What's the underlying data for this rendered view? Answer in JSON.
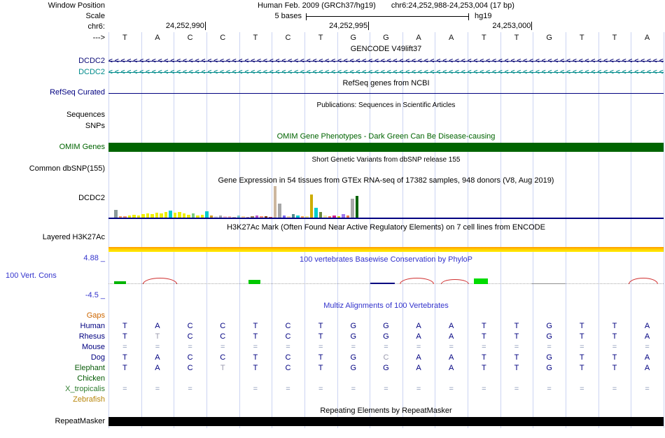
{
  "header": {
    "window_position_label": "Window Position",
    "assembly": "Human Feb. 2009 (GRCh37/hg19)",
    "position": "chr6:24,252,988-24,253,004 (17 bp)",
    "scale_label": "Scale",
    "scale_text": "5 bases",
    "assembly_short": "hg19",
    "chrom_label": "chr6:",
    "strand_arrow": "--->",
    "ruler_ticks": [
      {
        "label": "24,252,990",
        "boundary": 3
      },
      {
        "label": "24,252,995",
        "boundary": 8
      },
      {
        "label": "24,253,000",
        "boundary": 13
      }
    ],
    "sequence": [
      "T",
      "A",
      "C",
      "C",
      "T",
      "C",
      "T",
      "G",
      "G",
      "A",
      "A",
      "T",
      "T",
      "G",
      "T",
      "T",
      "A"
    ]
  },
  "gencode": {
    "title": "GENCODE V49lift37",
    "transcripts": [
      {
        "label": "DCDC2",
        "color": "#0c0c78",
        "strand": "<"
      },
      {
        "label": "DCDC2",
        "color": "#008b8b",
        "strand": "<"
      }
    ]
  },
  "refseq": {
    "label": "RefSeq Curated",
    "title": "RefSeq genes from NCBI",
    "color": "#000080"
  },
  "publications": {
    "title": "Publications: Sequences in Scientific Articles"
  },
  "sequences": {
    "label": "Sequences"
  },
  "snps": {
    "label": "SNPs"
  },
  "omim": {
    "label": "OMIM Genes",
    "title": "OMIM Gene Phenotypes - Dark Green Can Be Disease-causing",
    "color": "#006400"
  },
  "dbsnp": {
    "label": "Common dbSNP(155)",
    "title": "Short Genetic Variants from dbSNP release 155"
  },
  "gtex": {
    "label": "DCDC2",
    "title": "Gene Expression in 54 tissues from GTEx RNA-seq of 17382 samples, 948 donors (V8, Aug 2019)",
    "baseline_color": "#000080",
    "bars": [
      [
        11,
        "#8a9a9a"
      ],
      [
        2,
        "#ff9d57"
      ],
      [
        2,
        "#ee9572"
      ],
      [
        3,
        "#eeee00"
      ],
      [
        4,
        "#eeee00"
      ],
      [
        3,
        "#eeee00"
      ],
      [
        5,
        "#eeee00"
      ],
      [
        6,
        "#eeee00"
      ],
      [
        5,
        "#eeee00"
      ],
      [
        7,
        "#eeee00"
      ],
      [
        6,
        "#eeee00"
      ],
      [
        8,
        "#eeee00"
      ],
      [
        10,
        "#00cdcd"
      ],
      [
        7,
        "#eeee00"
      ],
      [
        8,
        "#eeee00"
      ],
      [
        6,
        "#eeee00"
      ],
      [
        4,
        "#eeee00"
      ],
      [
        6,
        "#7ccd7c"
      ],
      [
        3,
        "#eeee00"
      ],
      [
        4,
        "#eeee00"
      ],
      [
        9,
        "#00cdcd"
      ],
      [
        3,
        "#cd9b1d"
      ],
      [
        2,
        "#d9d9d9"
      ],
      [
        3,
        "#a6a6a6"
      ],
      [
        2,
        "#ffc0cb"
      ],
      [
        2,
        "#eeb4b4"
      ],
      [
        1,
        "#cdb79e"
      ],
      [
        3,
        "#7ac5cd"
      ],
      [
        2,
        "#ffd39b"
      ],
      [
        1,
        "#cd9b9b"
      ],
      [
        2,
        "#9a7b4f"
      ],
      [
        3,
        "#b452cd"
      ],
      [
        2,
        "#ff8c69"
      ],
      [
        2,
        "#8b4513"
      ],
      [
        1,
        "#cd5555"
      ],
      [
        45,
        "#cdb79e"
      ],
      [
        20,
        "#a6a6a6"
      ],
      [
        3,
        "#7a67ee"
      ],
      [
        2,
        "#ffd39b"
      ],
      [
        5,
        "#528b8b"
      ],
      [
        3,
        "#00ced1"
      ],
      [
        2,
        "#ffa54f"
      ],
      [
        2,
        "#eee685"
      ],
      [
        33,
        "#cdad00"
      ],
      [
        14,
        "#00cdcd"
      ],
      [
        8,
        "#6e8b3d"
      ],
      [
        3,
        "#eee8aa"
      ],
      [
        2,
        "#ff7f50"
      ],
      [
        3,
        "#d02090"
      ],
      [
        2,
        "#cdcd00"
      ],
      [
        5,
        "#9f79ee"
      ],
      [
        3,
        "#ee7942"
      ],
      [
        27,
        "#a9a9a9"
      ],
      [
        31,
        "#006400"
      ]
    ]
  },
  "h3k27ac": {
    "label": "Layered H3K27Ac",
    "title": "H3K27Ac Mark (Often Found Near Active Regulatory Elements) on 7 cell lines from ENCODE"
  },
  "conservation": {
    "label": "100 Vert. Cons",
    "title": "100 vertebrates Basewise Conservation by PhyloP",
    "axis_max": "4.88 _",
    "axis_min": "-4.5 _",
    "features": [
      {
        "type": "box",
        "col": 0.18,
        "w": 0.35,
        "h": 4,
        "color": "#00b400"
      },
      {
        "type": "arc",
        "col": 1.05,
        "w": 1.05,
        "h": 9,
        "color": "#d03030"
      },
      {
        "type": "box",
        "col": 4.28,
        "w": 0.38,
        "h": 6,
        "color": "#00c800"
      },
      {
        "type": "line",
        "col": 8.02,
        "w": 0.75,
        "h": 2,
        "color": "#000080"
      },
      {
        "type": "arc",
        "col": 8.92,
        "w": 1.05,
        "h": 9,
        "color": "#d03030"
      },
      {
        "type": "arc",
        "col": 10.18,
        "w": 0.85,
        "h": 7,
        "color": "#d03030"
      },
      {
        "type": "box",
        "col": 11.18,
        "w": 0.45,
        "h": 8,
        "color": "#00dc00"
      },
      {
        "type": "line",
        "col": 12.95,
        "w": 1.05,
        "h": 1,
        "color": "#909090"
      },
      {
        "type": "arc",
        "col": 15.92,
        "w": 0.9,
        "h": 9,
        "color": "#d03030"
      }
    ]
  },
  "multiz": {
    "title": "Multiz Alignments of 100 Vertebrates",
    "rows": [
      {
        "label": "Gaps",
        "label_color": "#cd6600",
        "cell_color": "#8b97b8",
        "dim": [],
        "cells": [
          "",
          "",
          "",
          "",
          "",
          "",
          "",
          "",
          "",
          "",
          "",
          "",
          "",
          "",
          "",
          "",
          ""
        ]
      },
      {
        "label": "Human",
        "label_color": "#000080",
        "cell_color": "#000080",
        "dim": [],
        "cells": [
          "T",
          "A",
          "C",
          "C",
          "T",
          "C",
          "T",
          "G",
          "G",
          "A",
          "A",
          "T",
          "T",
          "G",
          "T",
          "T",
          "A"
        ]
      },
      {
        "label": "Rhesus",
        "label_color": "#000080",
        "cell_color": "#000080",
        "dim": [
          1
        ],
        "cells": [
          "T",
          "T",
          "C",
          "C",
          "T",
          "C",
          "T",
          "G",
          "G",
          "A",
          "A",
          "T",
          "T",
          "G",
          "T",
          "T",
          "A"
        ]
      },
      {
        "label": "Mouse",
        "label_color": "#000080",
        "cell_color": "#8b97b8",
        "dim": [],
        "cells": [
          "=",
          "=",
          "=",
          "=",
          "=",
          "=",
          "=",
          "=",
          "=",
          "=",
          "=",
          "=",
          "=",
          "=",
          "=",
          "=",
          "="
        ]
      },
      {
        "label": "Dog",
        "label_color": "#000080",
        "cell_color": "#000080",
        "dim": [
          8
        ],
        "cells": [
          "T",
          "A",
          "C",
          "C",
          "T",
          "C",
          "T",
          "G",
          "C",
          "A",
          "A",
          "T",
          "T",
          "G",
          "T",
          "T",
          "A"
        ]
      },
      {
        "label": "Elephant",
        "label_color": "#0b5d0b",
        "cell_color": "#000080",
        "dim": [
          3
        ],
        "cells": [
          "T",
          "A",
          "C",
          "T",
          "T",
          "C",
          "T",
          "G",
          "G",
          "A",
          "A",
          "T",
          "T",
          "G",
          "T",
          "T",
          "A"
        ]
      },
      {
        "label": "Chicken",
        "label_color": "#005900",
        "cell_color": "#000080",
        "dim": [],
        "cells": [
          "",
          "",
          "",
          "",
          "",
          "",
          "",
          "",
          "",
          "",
          "",
          "",
          "",
          "",
          "",
          "",
          ""
        ]
      },
      {
        "label": "X_tropicalis",
        "label_color": "#2f7d2f",
        "cell_color": "#8b97b8",
        "dim": [],
        "cells": [
          "=",
          "=",
          "=",
          "",
          "=",
          "=",
          "=",
          "=",
          "=",
          "=",
          "=",
          "=",
          "=",
          "=",
          "=",
          "=",
          "="
        ]
      },
      {
        "label": "Zebrafish",
        "label_color": "#b8860b",
        "cell_color": "#000080",
        "dim": [],
        "cells": [
          "",
          "",
          "",
          "",
          "",
          "",
          "",
          "",
          "",
          "",
          "",
          "",
          "",
          "",
          "",
          "",
          ""
        ]
      }
    ]
  },
  "repeatmasker": {
    "label": "RepeatMasker",
    "title": "Repeating Elements by RepeatMasker"
  },
  "colors": {
    "guideline": "#ccd4f2",
    "title_blue": "#3333cc"
  }
}
